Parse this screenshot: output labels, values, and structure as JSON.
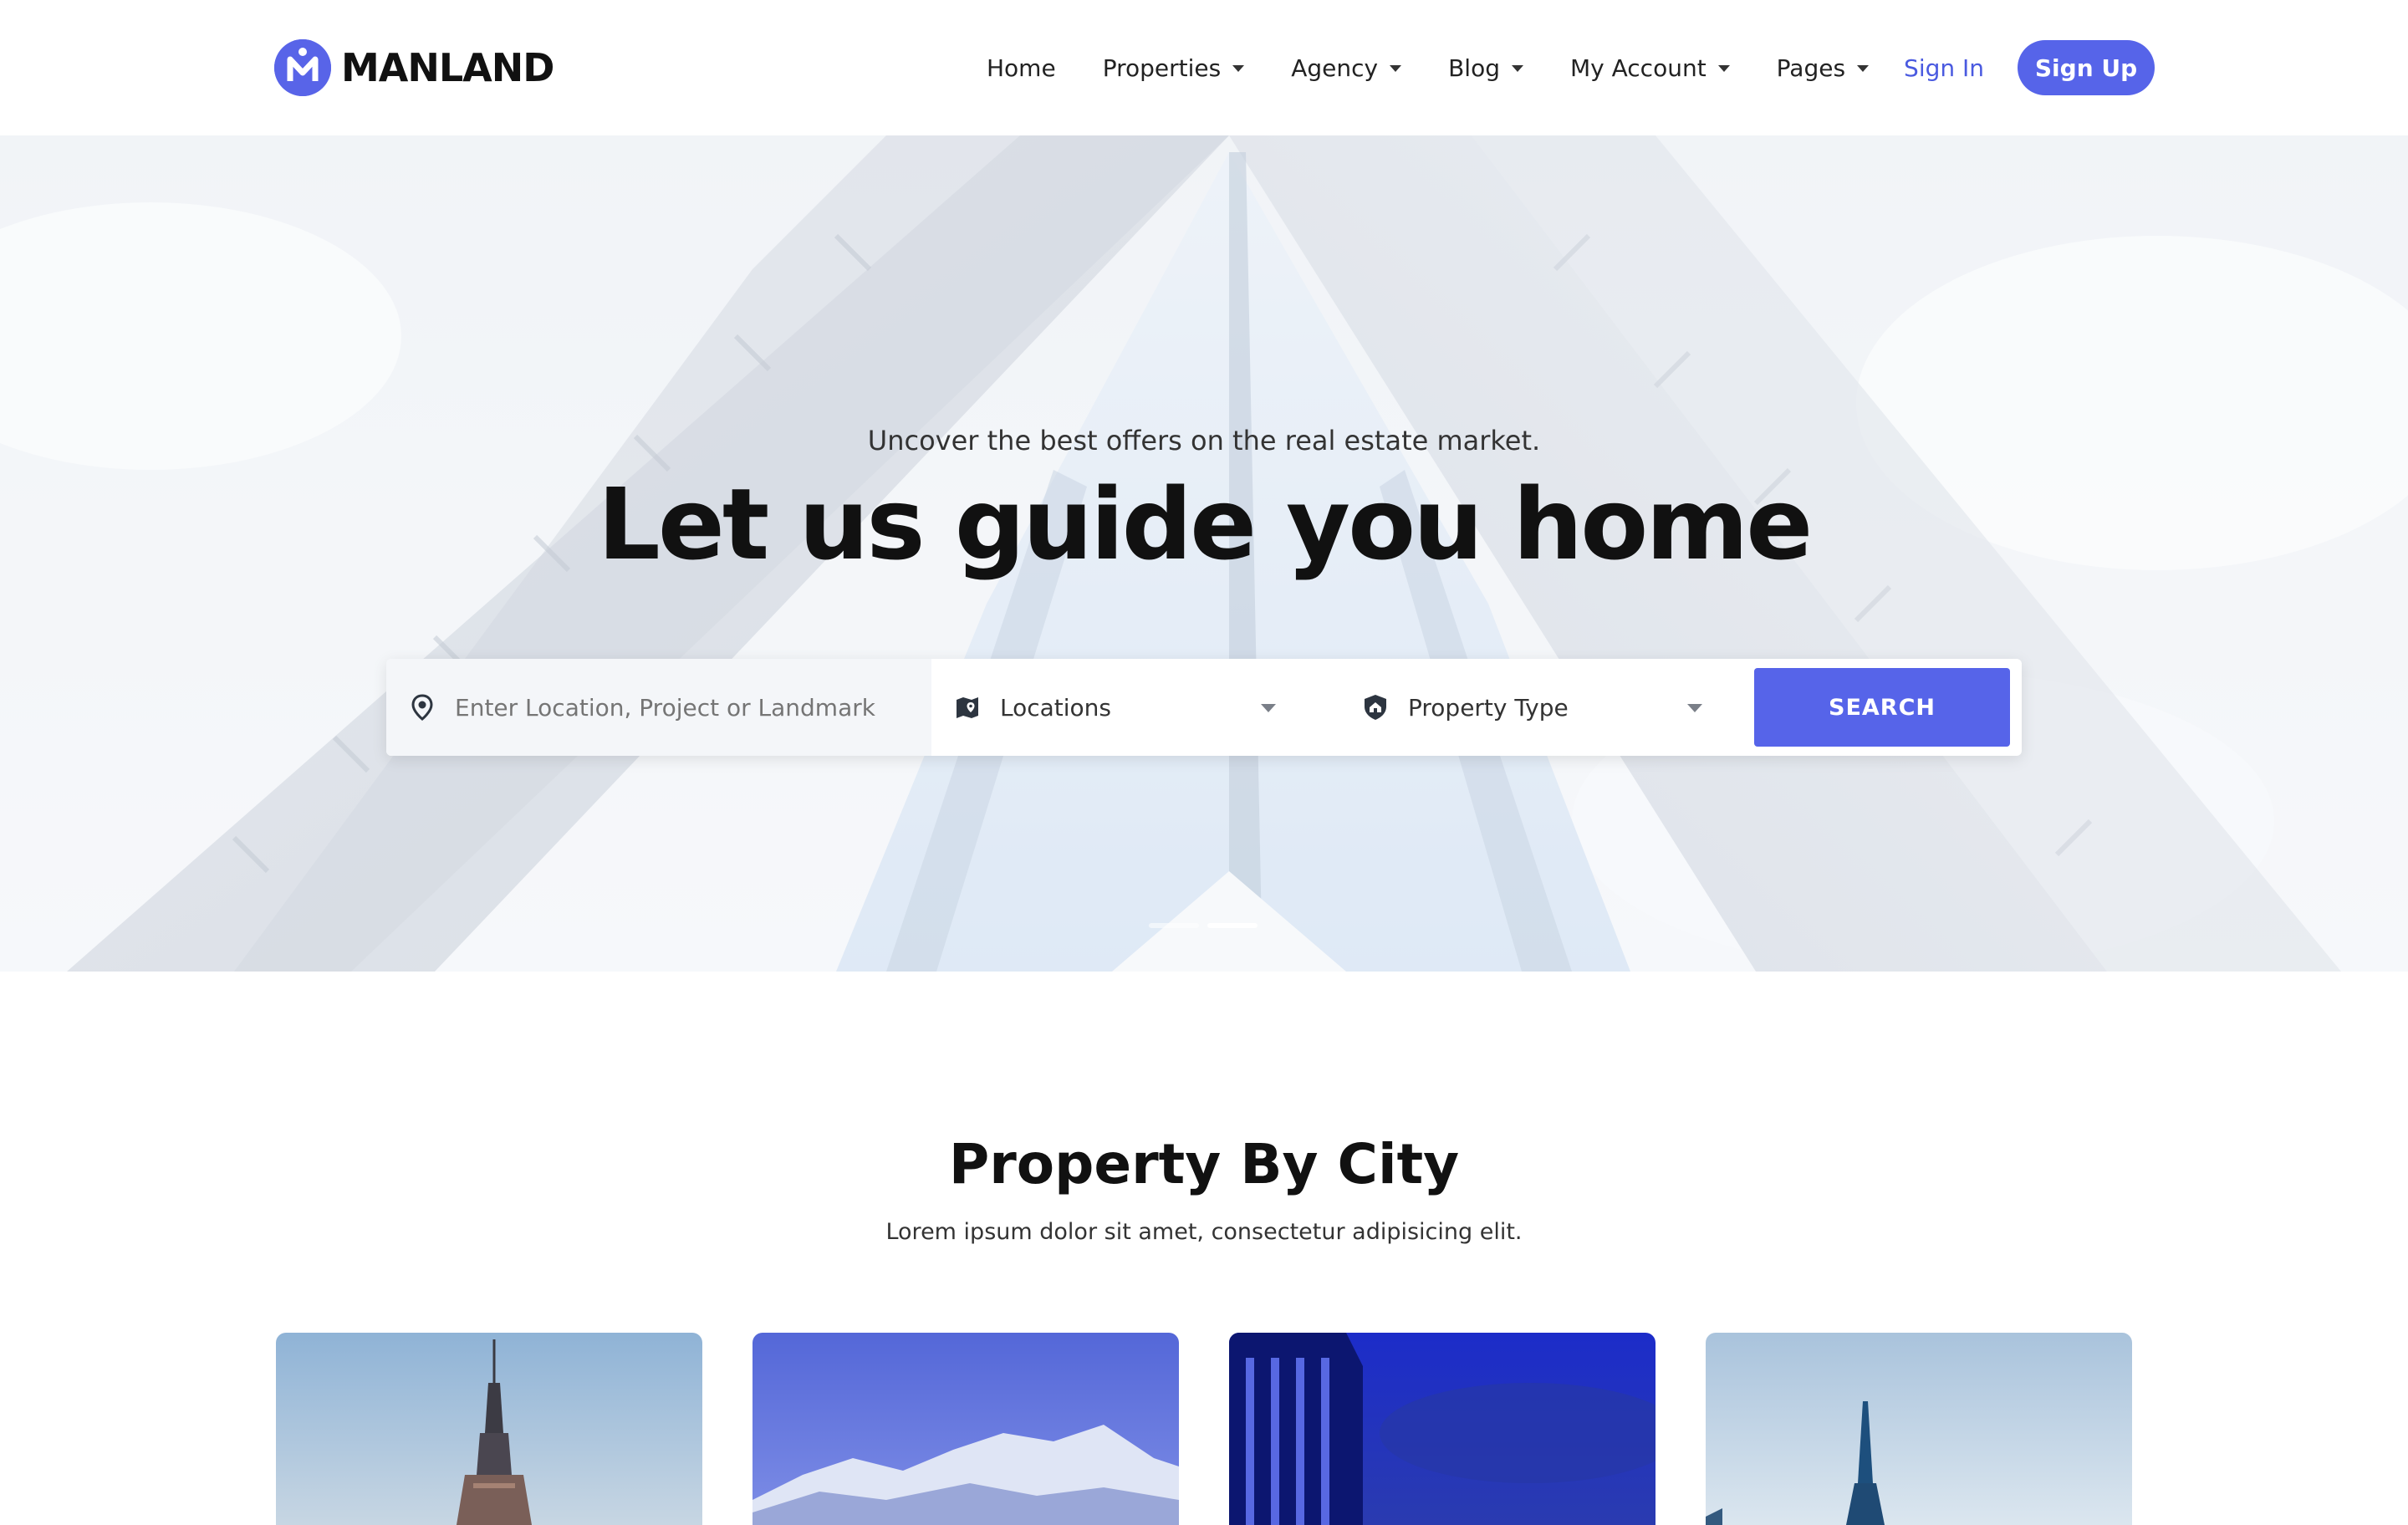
{
  "brand": {
    "name": "MANLAND",
    "logo_letter": "M",
    "accent": "#5664e9"
  },
  "nav": {
    "items": [
      {
        "label": "Home",
        "has_dropdown": false
      },
      {
        "label": "Properties",
        "has_dropdown": true
      },
      {
        "label": "Agency",
        "has_dropdown": true
      },
      {
        "label": "Blog",
        "has_dropdown": true
      },
      {
        "label": "My Account",
        "has_dropdown": true
      },
      {
        "label": "Pages",
        "has_dropdown": true
      }
    ],
    "sign_in": "Sign In",
    "sign_up": "Sign Up"
  },
  "hero": {
    "subtitle": "Uncover the best offers on the real estate market.",
    "title": "Let us guide you home",
    "search": {
      "location_placeholder": "Enter Location, Project or Landmark",
      "locations_select": "Locations",
      "property_type_select": "Property Type",
      "button": "SEARCH"
    },
    "slides": {
      "count": 2,
      "active": 1
    }
  },
  "city_section": {
    "title": "Property By City",
    "subtitle": "Lorem ipsum dolor sit amet, consectetur adipisicing elit."
  },
  "icons": {
    "location": "map-pin-icon",
    "locations": "map-icon",
    "property_type": "home-shield-icon",
    "caret": "chevron-down-icon"
  }
}
